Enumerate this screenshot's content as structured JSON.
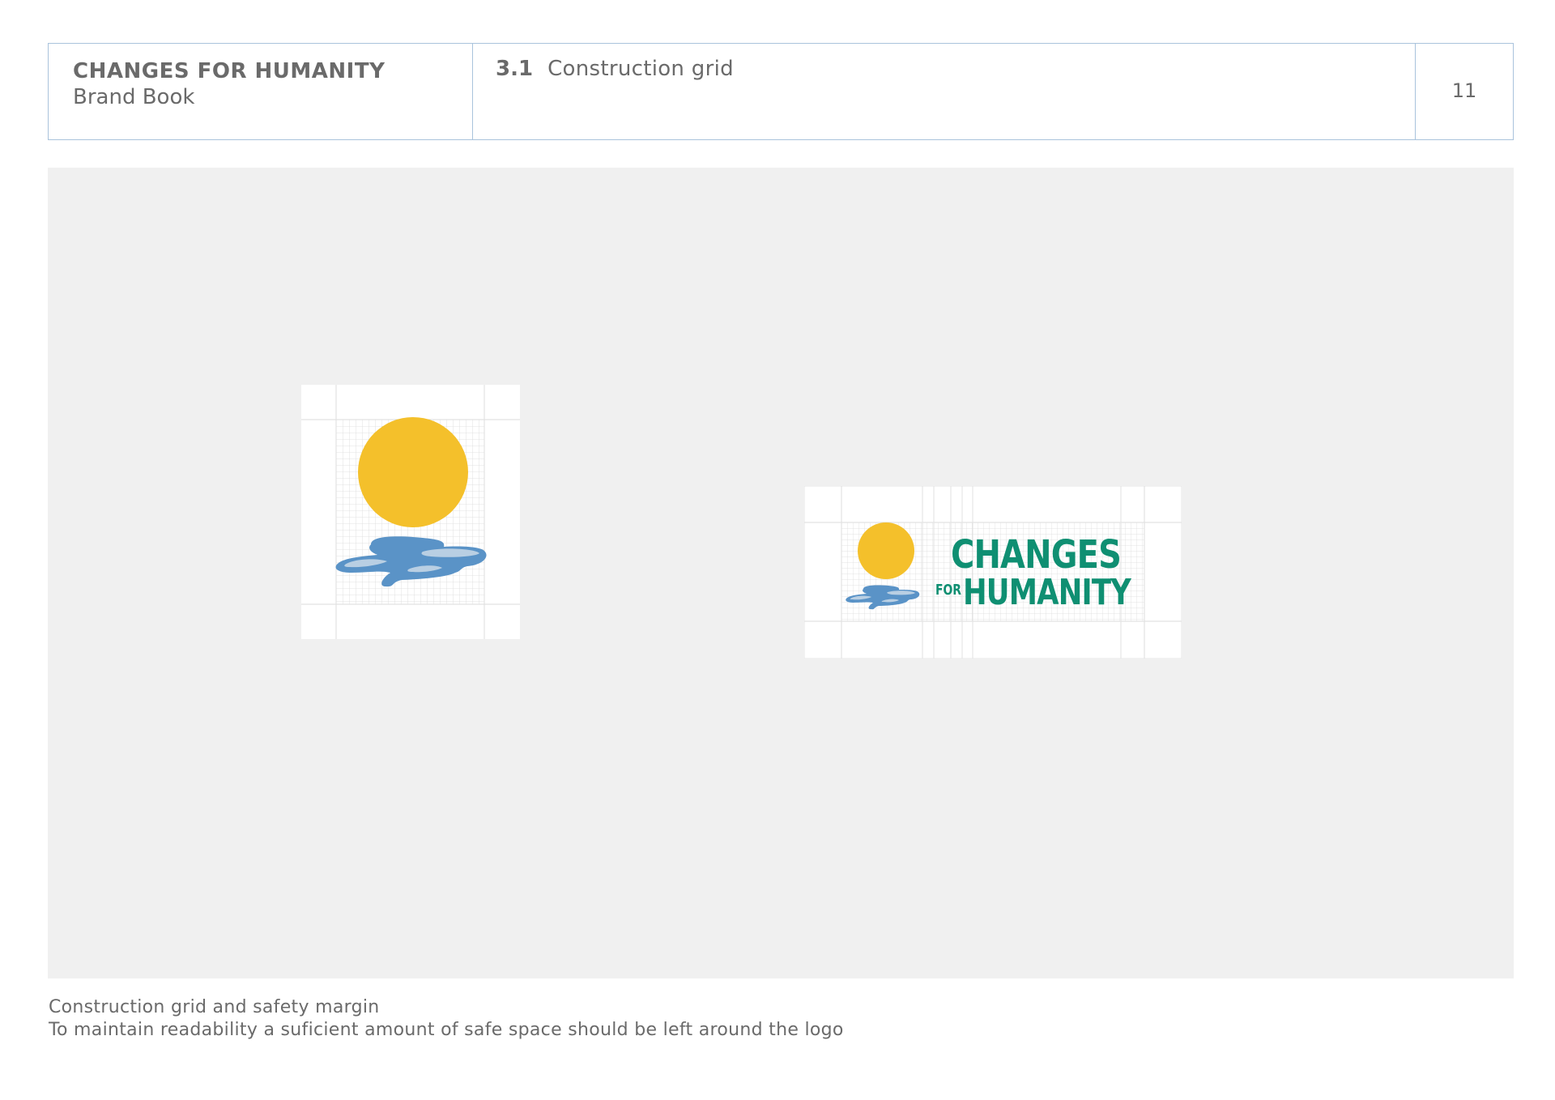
{
  "header": {
    "brand_title": "CHANGES FOR HUMANITY",
    "brand_subtitle": "Brand Book",
    "section_number": "3.1",
    "section_title": "Construction grid",
    "page_number": "11"
  },
  "logo": {
    "wordmark_line1": "CHANGES",
    "wordmark_for": "FOR",
    "wordmark_line2": "HUMANITY",
    "colors": {
      "sun": "#f4c02b",
      "water": "#5a93c7",
      "water_highlight": "#b9cfe3",
      "wordmark": "#0f8f72",
      "grid": "#d9d9d9",
      "margin_lines": "#e4e4e4"
    }
  },
  "captions": {
    "line1": "Construction grid and safety margin",
    "line2": "To maintain readability a suficient amount of safe space should be left around the logo"
  }
}
